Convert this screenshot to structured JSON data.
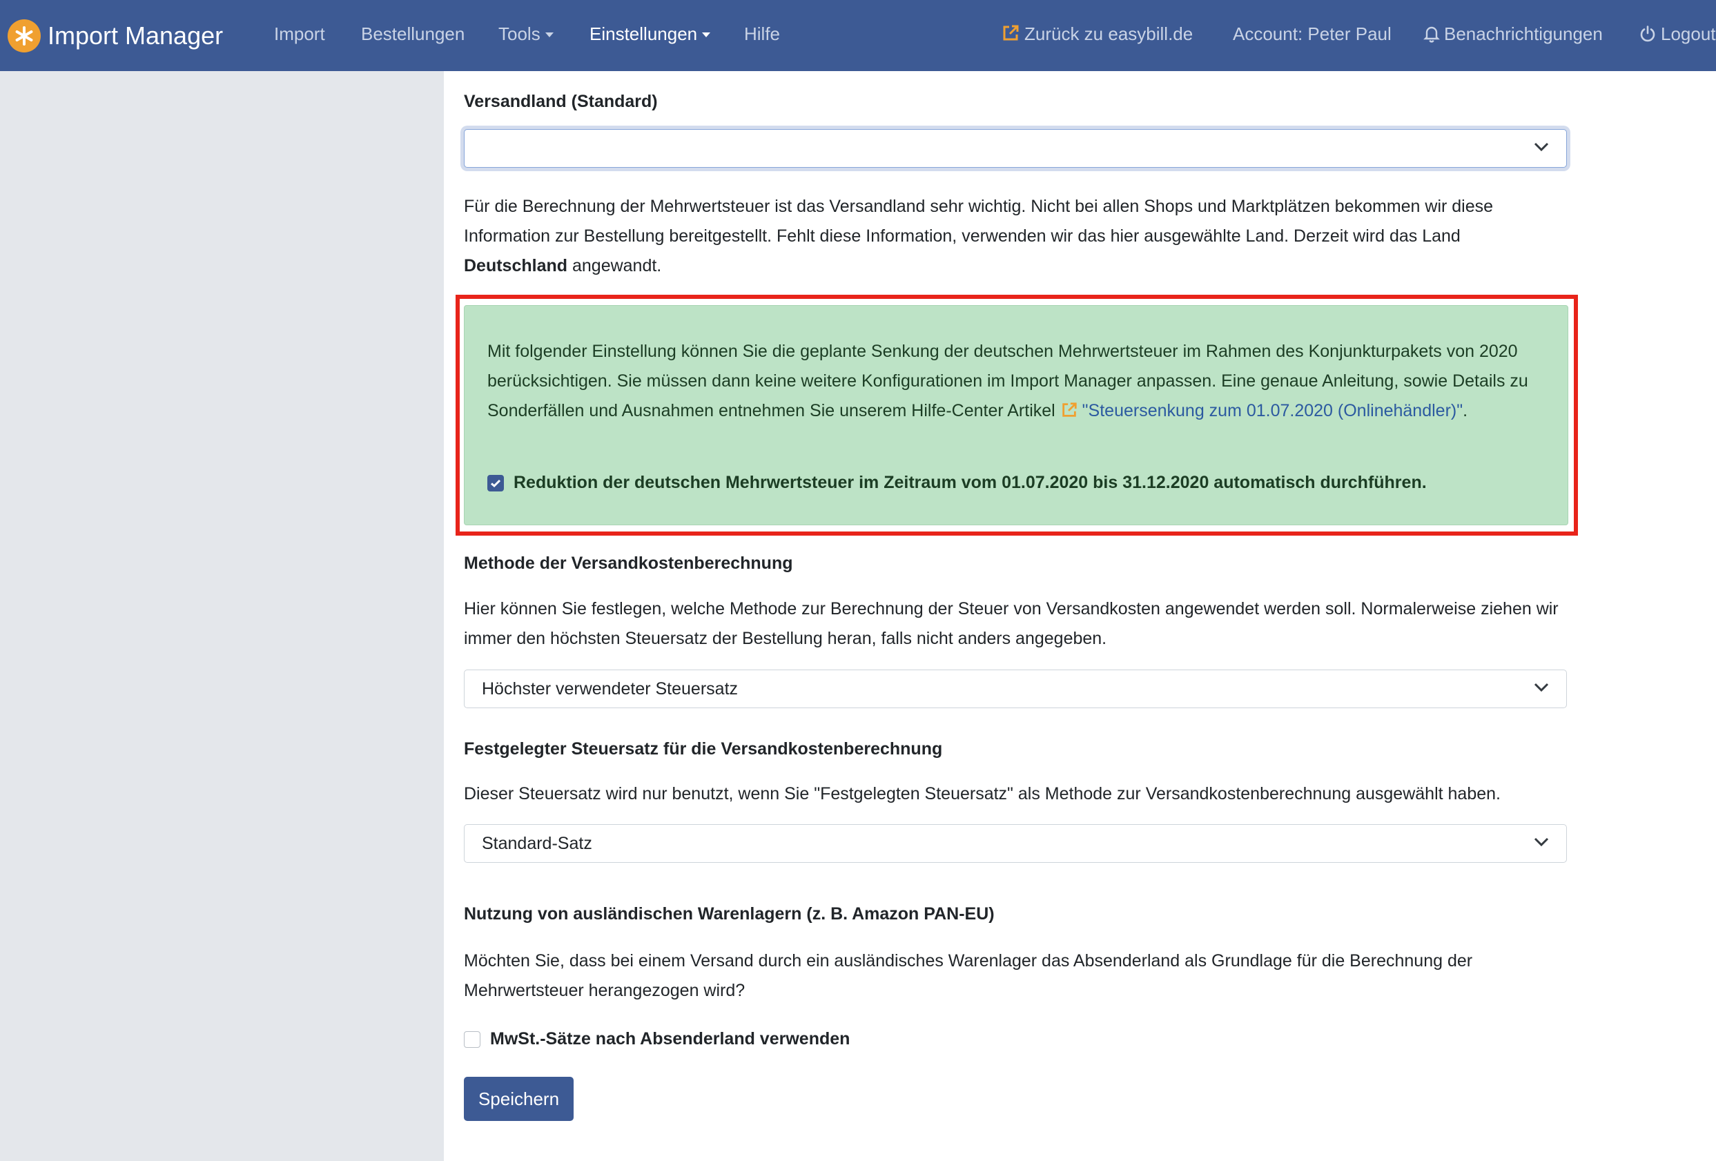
{
  "navbar": {
    "brand": "Import Manager",
    "links": [
      {
        "label": "Import"
      },
      {
        "label": "Bestellungen"
      },
      {
        "label": "Tools"
      },
      {
        "label": "Einstellungen"
      },
      {
        "label": "Hilfe"
      }
    ],
    "back_link": "Zurück zu easybill.de",
    "account": "Account: Peter Paul",
    "notifications": "Benachrichtigungen",
    "logout": "Logout"
  },
  "settings": {
    "shipping_country": {
      "label": "Versandland (Standard)",
      "value": "",
      "help_part1": "Für die Berechnung der Mehrwertsteuer ist das Versandland sehr wichtig. Nicht bei allen Shops und Marktplätzen bekommen wir diese Information zur Bestellung bereitgestellt. Fehlt diese Information, verwenden wir das hier ausgewählte Land. Derzeit wird das Land",
      "current_country": "Deutschland",
      "help_part2": "angewandt."
    },
    "vat_reduction": {
      "text": "Mit folgender Einstellung können Sie die geplante Senkung der deutschen Mehrwertsteuer im Rahmen des Konjunkturpakets von 2020 berücksichtigen. Sie müssen dann keine weitere Konfigurationen im Import Manager anpassen. Eine genaue Anleitung, sowie Details zu Sonderfällen und Ausnahmen entnehmen Sie unserem Hilfe-Center Artikel",
      "link_text": "\"Steuersenkung zum 01.07.2020 (Onlinehändler)\"",
      "text_end": ".",
      "checkbox_label": "Reduktion der deutschen Mehrwertsteuer im Zeitraum vom 01.07.2020 bis 31.12.2020 automatisch durchführen.",
      "checked": true
    },
    "shipping_method": {
      "label": "Methode der Versandkostenberechnung",
      "help": "Hier können Sie festlegen, welche Methode zur Berechnung der Steuer von Versandkosten angewendet werden soll. Normalerweise ziehen wir immer den höchsten Steuersatz der Bestellung heran, falls nicht anders angegeben.",
      "value": "Höchster verwendeter Steuersatz"
    },
    "fixed_rate": {
      "label": "Festgelegter Steuersatz für die Versandkostenberechnung",
      "help": "Dieser Steuersatz wird nur benutzt, wenn Sie \"Festgelegten Steuersatz\" als Methode zur Versandkostenberechnung ausgewählt haben.",
      "value": "Standard-Satz"
    },
    "foreign_warehouse": {
      "label": "Nutzung von ausländischen Warenlagern (z. B. Amazon PAN-EU)",
      "help": "Möchten Sie, dass bei einem Versand durch ein ausländisches Warenlager das Absenderland als Grundlage für die Berechnung der Mehrwertsteuer herangezogen wird?",
      "checkbox_label": "MwSt.-Sätze nach Absenderland verwenden",
      "checked": false
    },
    "save_button": "Speichern"
  },
  "colors": {
    "navbar": "#3d5a94",
    "brand_logo": "#f0a030",
    "alert_background": "#bde3c6",
    "highlight_border": "#e8241a",
    "primary_button": "#3d5a94"
  },
  "icons": [
    "asterisk-logo-icon",
    "external-link-icon",
    "bell-icon",
    "power-icon",
    "chevron-down-icon",
    "checkmark-icon"
  ]
}
